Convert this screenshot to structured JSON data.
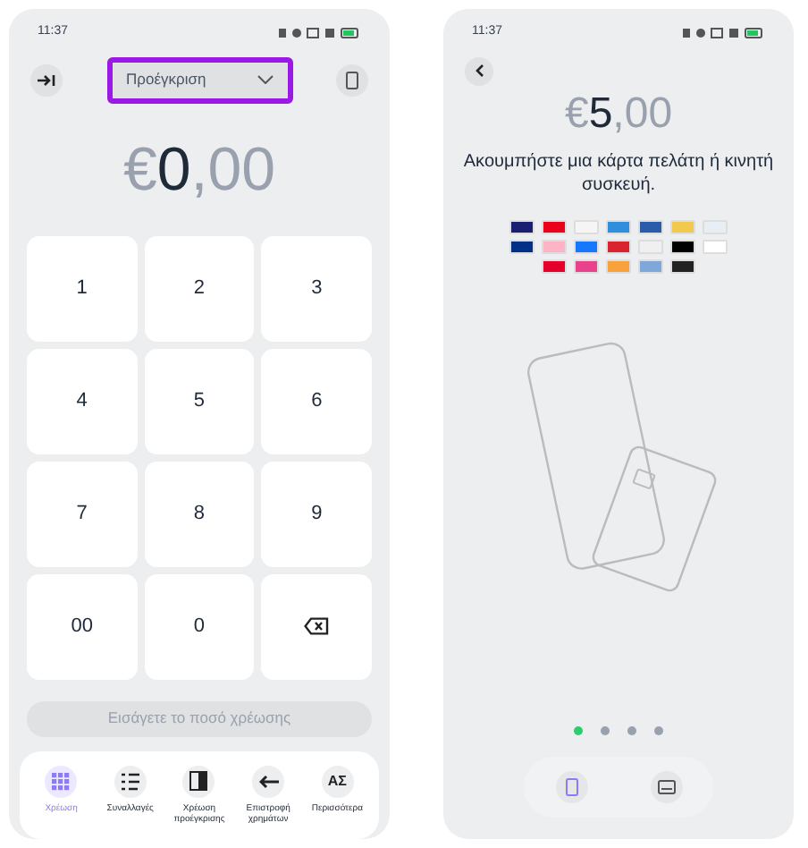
{
  "left_screen": {
    "status_time": "11:37",
    "mode_dropdown": {
      "value": "Προέγκριση",
      "highlighted": true
    },
    "amount": {
      "currency": "€",
      "whole": "0",
      "decimal": ",00"
    },
    "keypad": [
      {
        "kind": "digit",
        "label": "1"
      },
      {
        "kind": "digit",
        "label": "2"
      },
      {
        "kind": "digit",
        "label": "3"
      },
      {
        "kind": "digit",
        "label": "4"
      },
      {
        "kind": "digit",
        "label": "5"
      },
      {
        "kind": "digit",
        "label": "6"
      },
      {
        "kind": "digit",
        "label": "7"
      },
      {
        "kind": "digit",
        "label": "8"
      },
      {
        "kind": "digit",
        "label": "9"
      },
      {
        "kind": "digit",
        "label": "00"
      },
      {
        "kind": "digit",
        "label": "0"
      },
      {
        "kind": "backspace"
      }
    ],
    "charge_button": {
      "label": "Εισάγετε το ποσό χρέωσης",
      "disabled": true
    },
    "nav": [
      {
        "kind": "grid",
        "label": "Χρέωση",
        "selected": true
      },
      {
        "kind": "list",
        "label": "Συναλλαγές",
        "selected": false
      },
      {
        "kind": "door",
        "label": "Χρέωση προέγκρισης",
        "selected": false
      },
      {
        "kind": "arrow",
        "label": "Επιστροφή χρημάτων",
        "selected": false
      },
      {
        "kind": "text",
        "icon_text": "ΑΣ",
        "label": "Περισσότερα",
        "selected": false
      }
    ]
  },
  "right_screen": {
    "status_time": "11:37",
    "amount": {
      "currency": "€",
      "whole": "5",
      "decimal": ",00"
    },
    "instruction": "Ακουμπήστε μια κάρτα πελάτη ή κινητή συσκευή.",
    "pages": [
      {
        "selected": true
      },
      {
        "selected": false
      },
      {
        "selected": false
      },
      {
        "selected": false
      }
    ],
    "bottom_tabs": [
      {
        "kind": "phone",
        "selected": true
      },
      {
        "kind": "card",
        "selected": false
      }
    ]
  }
}
